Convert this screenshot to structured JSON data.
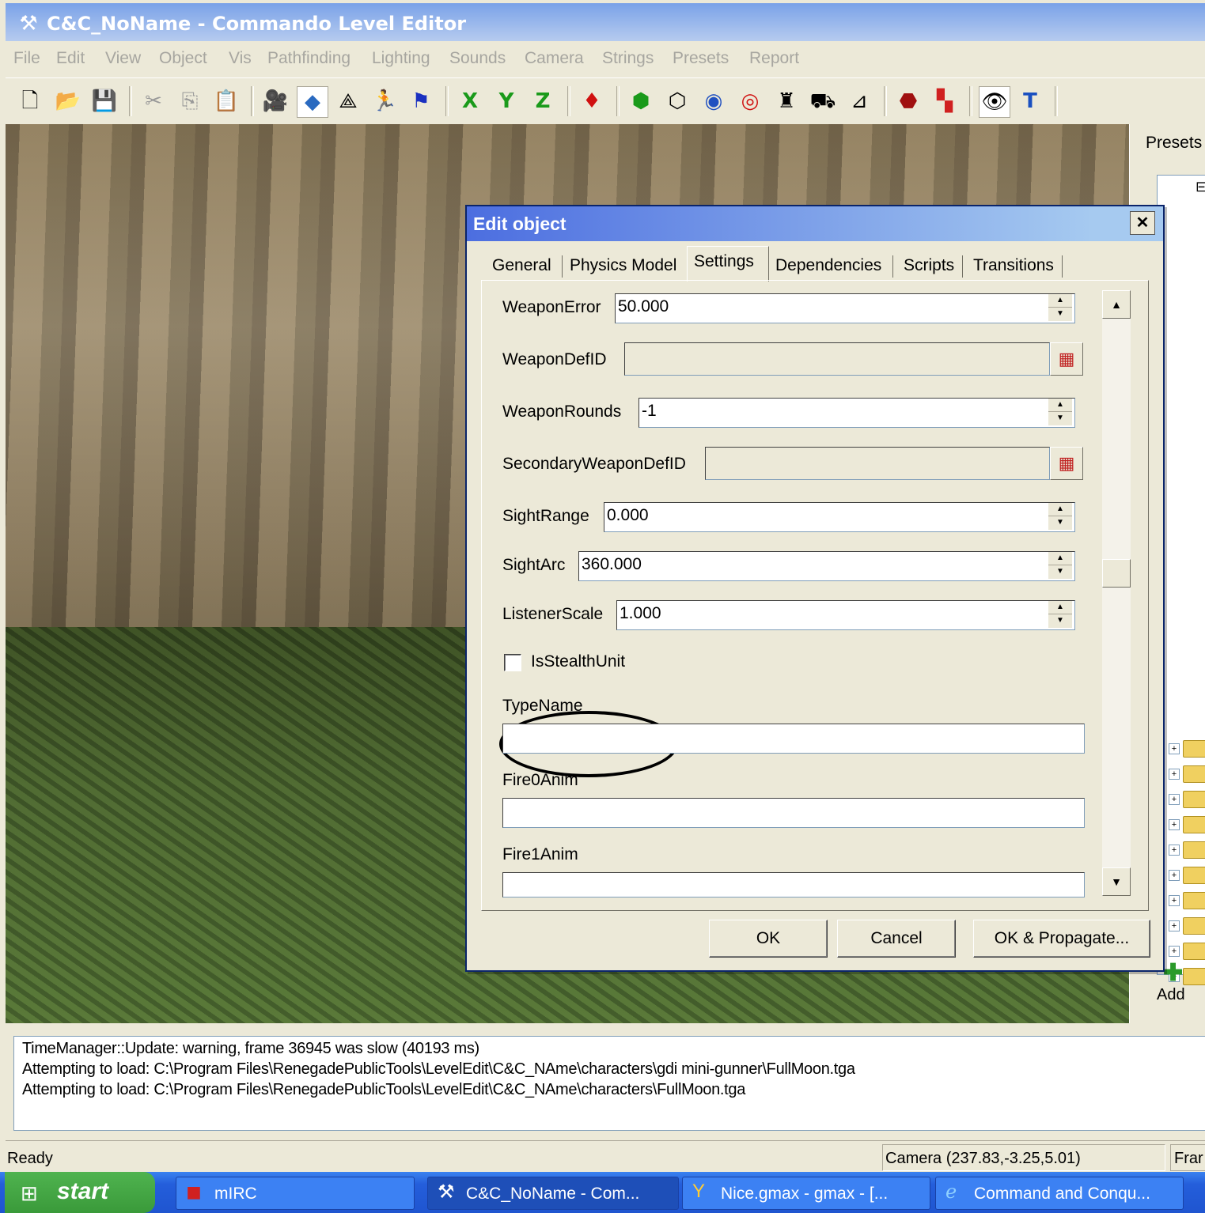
{
  "window": {
    "title": "C&C_NoName - Commando Level Editor",
    "app_icon": "tools-icon"
  },
  "menu": [
    "File",
    "Edit",
    "View",
    "Object",
    "Vis",
    "Pathfinding",
    "Lighting",
    "Sounds",
    "Camera",
    "Strings",
    "Presets",
    "Report"
  ],
  "toolbar": {
    "axis_x": "X",
    "axis_y": "Y",
    "axis_z": "Z",
    "text_tool": "T"
  },
  "right_panel": {
    "title": "Presets",
    "add_label": "Add"
  },
  "dialog": {
    "title": "Edit object",
    "close": "✕",
    "tabs": [
      "General",
      "Physics Model",
      "Settings",
      "Dependencies",
      "Scripts",
      "Transitions"
    ],
    "active_tab": "Settings",
    "fields": {
      "weapon_error": {
        "label": "WeaponError",
        "value": "50.000"
      },
      "weapon_def_id": {
        "label": "WeaponDefID",
        "value": ""
      },
      "weapon_rounds": {
        "label": "WeaponRounds",
        "value": "-1"
      },
      "secondary_weapon_def_id": {
        "label": "SecondaryWeaponDefID",
        "value": ""
      },
      "sight_range": {
        "label": "SightRange",
        "value": "0.000"
      },
      "sight_arc": {
        "label": "SightArc",
        "value": "360.000"
      },
      "listener_scale": {
        "label": "ListenerScale",
        "value": "1.000"
      },
      "is_stealth_unit": {
        "label": "IsStealthUnit",
        "checked": false
      },
      "type_name": {
        "label": "TypeName",
        "value": ""
      },
      "fire0_anim": {
        "label": "Fire0Anim",
        "value": ""
      },
      "fire1_anim": {
        "label": "Fire1Anim",
        "value": ""
      }
    },
    "buttons": {
      "ok": "OK",
      "cancel": "Cancel",
      "ok_propagate": "OK & Propagate..."
    }
  },
  "log": [
    "TimeManager::Update: warning, frame 36945 was slow (40193 ms)",
    "Attempting to load: C:\\Program Files\\RenegadePublicTools\\LevelEdit\\C&C_NAme\\characters\\gdi mini-gunner\\FullMoon.tga",
    "Attempting to load: C:\\Program Files\\RenegadePublicTools\\LevelEdit\\C&C_NAme\\characters\\FullMoon.tga"
  ],
  "status": {
    "ready": "Ready",
    "camera": "Camera (237.83,-3.25,5.01)",
    "frame": "Frar"
  },
  "taskbar": {
    "start": "start",
    "tasks": [
      {
        "label": "mIRC",
        "icon": "mirc-icon"
      },
      {
        "label": "C&C_NoName - Com...",
        "icon": "tools-icon",
        "active": true
      },
      {
        "label": "Nice.gmax - gmax - [...",
        "icon": "gmax-icon"
      },
      {
        "label": "Command and Conqu...",
        "icon": "ie-icon"
      }
    ]
  },
  "colors": {
    "title_blue": "#7aa2e8",
    "dialog_title": "#4c6ee0",
    "taskbar_blue": "#245edb",
    "start_green": "#3a9a3a"
  }
}
